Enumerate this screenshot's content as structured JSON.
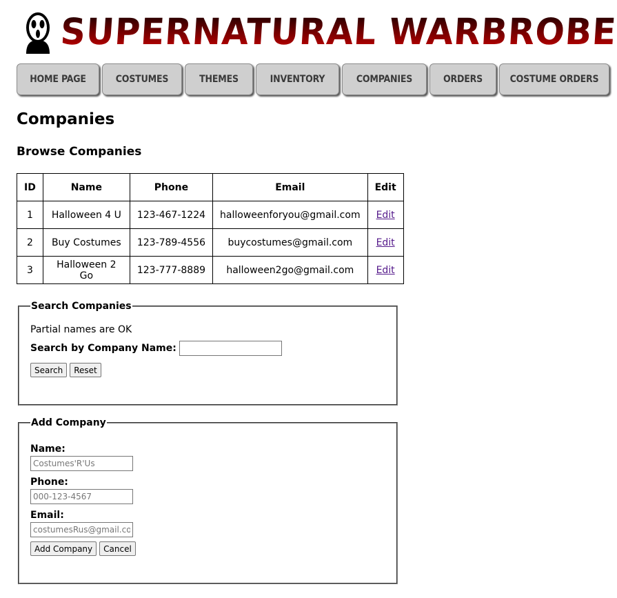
{
  "header": {
    "title": "SUPERNATURAL WARBROBE",
    "logo": "ghostface-mask-icon"
  },
  "nav": {
    "items": [
      {
        "label": "HOME PAGE"
      },
      {
        "label": "COSTUMES"
      },
      {
        "label": "THEMES"
      },
      {
        "label": "INVENTORY"
      },
      {
        "label": "COMPANIES"
      },
      {
        "label": "ORDERS"
      },
      {
        "label": "COSTUME ORDERS"
      }
    ]
  },
  "page": {
    "title": "Companies",
    "section_title": "Browse Companies"
  },
  "table": {
    "headers": [
      "ID",
      "Name",
      "Phone",
      "Email",
      "Edit"
    ],
    "rows": [
      {
        "id": "1",
        "name": "Halloween 4 U",
        "phone": "123-467-1224",
        "email": "halloweenforyou@gmail.com",
        "edit": "Edit"
      },
      {
        "id": "2",
        "name": "Buy Costumes",
        "phone": "123-789-4556",
        "email": "buycostumes@gmail.com",
        "edit": "Edit"
      },
      {
        "id": "3",
        "name": "Halloween 2 Go",
        "phone": "123-777-8889",
        "email": "halloween2go@gmail.com",
        "edit": "Edit"
      }
    ]
  },
  "search": {
    "legend": "Search Companies",
    "hint": "Partial names are OK",
    "label": "Search by Company Name:",
    "value": "",
    "search_button": "Search",
    "reset_button": "Reset"
  },
  "add": {
    "legend": "Add Company",
    "name_label": "Name:",
    "name_placeholder": "Costumes'R'Us",
    "phone_label": "Phone:",
    "phone_placeholder": "000-123-4567",
    "email_label": "Email:",
    "email_placeholder": "costumesRus@gmail.com",
    "submit_button": "Add Company",
    "cancel_button": "Cancel"
  }
}
